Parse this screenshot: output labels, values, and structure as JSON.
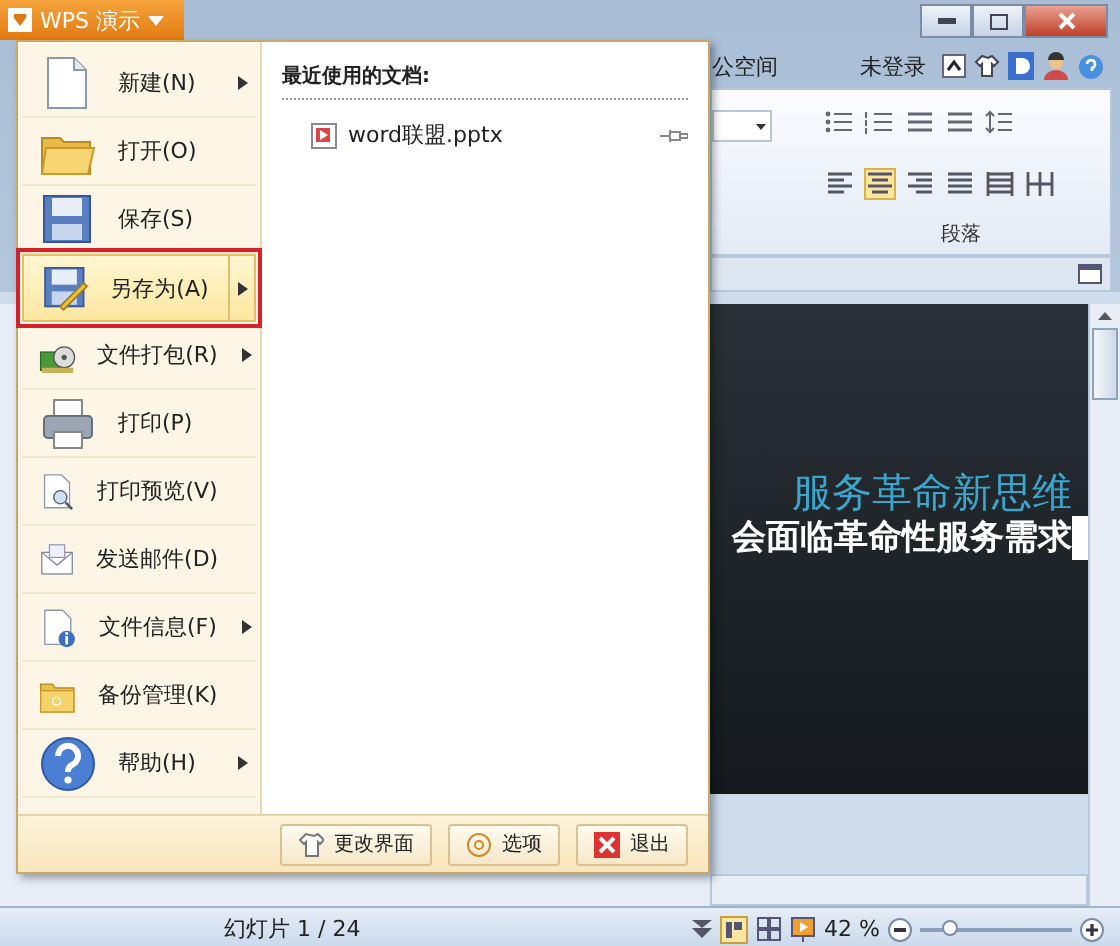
{
  "app": {
    "app_button": "WPS 演示",
    "title_fragment": "公空间",
    "login": "未登录",
    "ribbon_group": "段落",
    "paragraph_buttons": [
      {
        "selected": false
      },
      {
        "selected": true
      },
      {
        "selected": false
      },
      {
        "selected": false
      },
      {
        "selected": false
      },
      {
        "selected": false
      }
    ]
  },
  "menu": {
    "items": [
      {
        "label": "新建(N)",
        "has_submenu": true,
        "selected": false
      },
      {
        "label": "打开(O)",
        "has_submenu": false,
        "selected": false
      },
      {
        "label": "保存(S)",
        "has_submenu": false,
        "selected": false
      },
      {
        "label": "另存为(A)",
        "has_submenu": true,
        "selected": true
      },
      {
        "label": "文件打包(R)",
        "has_submenu": true,
        "selected": false
      },
      {
        "label": "打印(P)",
        "has_submenu": false,
        "selected": false
      },
      {
        "label": "打印预览(V)",
        "has_submenu": false,
        "selected": false
      },
      {
        "label": "发送邮件(D)",
        "has_submenu": false,
        "selected": false
      },
      {
        "label": "文件信息(F)",
        "has_submenu": true,
        "selected": false
      },
      {
        "label": "备份管理(K)",
        "has_submenu": false,
        "selected": false
      },
      {
        "label": "帮助(H)",
        "has_submenu": true,
        "selected": false
      }
    ],
    "recent_header": "最近使用的文档:",
    "recent_files": [
      {
        "name": "word联盟.pptx"
      }
    ],
    "footer_buttons": [
      "更改界面",
      "选项",
      "退出"
    ]
  },
  "slide": {
    "title": "服务革命新思维",
    "subtitle": "会面临革命性服务需求"
  },
  "status_bar": {
    "slide_counter": "幻灯片 1 / 24",
    "zoom": "42 %",
    "zoom_slider": {
      "level": 0.2
    }
  }
}
